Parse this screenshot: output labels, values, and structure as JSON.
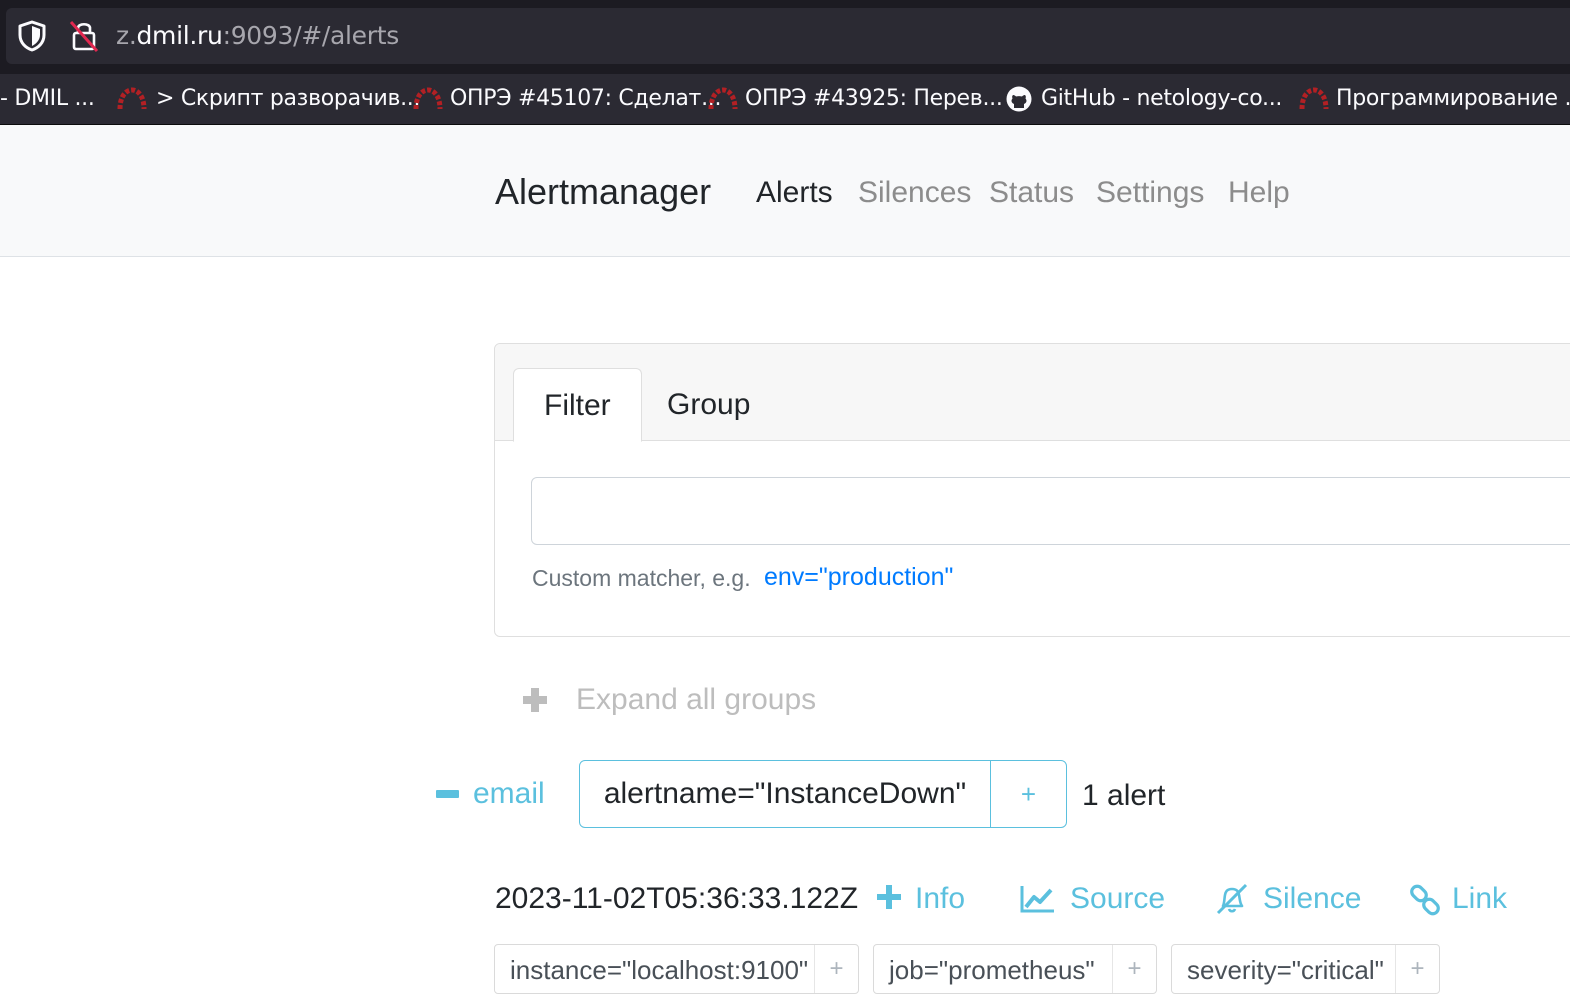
{
  "browser": {
    "url_prefix": "z.",
    "url_host": "dmil.ru",
    "url_rest": ":9093/#/alerts",
    "bookmarks": [
      {
        "label": "- DMIL ...",
        "icon": "none"
      },
      {
        "label": "> Скрипт разворачив...",
        "icon": "redmine-icon"
      },
      {
        "label": "ОПРЭ #45107: Сделат...",
        "icon": "redmine-icon"
      },
      {
        "label": "ОПРЭ #43925: Перев...",
        "icon": "redmine-icon"
      },
      {
        "label": "GitHub - netology-co...",
        "icon": "github-icon"
      },
      {
        "label": "Программирование ...",
        "icon": "redmine-icon"
      }
    ]
  },
  "navbar": {
    "brand": "Alertmanager",
    "links": [
      {
        "label": "Alerts",
        "active": true
      },
      {
        "label": "Silences",
        "active": false
      },
      {
        "label": "Status",
        "active": false
      },
      {
        "label": "Settings",
        "active": false
      },
      {
        "label": "Help",
        "active": false
      }
    ]
  },
  "filter_card": {
    "tabs": [
      {
        "label": "Filter",
        "active": true
      },
      {
        "label": "Group",
        "active": false
      }
    ],
    "input_value": "",
    "hint_text": "Custom matcher, e.g.",
    "hint_example": "env=\"production\""
  },
  "expand_all": {
    "label": "Expand all groups"
  },
  "group": {
    "receiver": "email",
    "matcher": "alertname=\"InstanceDown\"",
    "add_symbol": "+",
    "count_label": "1 alert"
  },
  "alert": {
    "timestamp": "2023-11-02T05:36:33.122Z",
    "actions": {
      "info": "Info",
      "source": "Source",
      "silence": "Silence",
      "link": "Link"
    },
    "labels": [
      {
        "text": "instance=\"localhost:9100\"",
        "add": "+"
      },
      {
        "text": "job=\"prometheus\"",
        "add": "+"
      },
      {
        "text": "severity=\"critical\"",
        "add": "+"
      }
    ]
  },
  "colors": {
    "accent_info": "#5bc0de",
    "link_blue": "#007bff",
    "navbar_bg": "#f8f9fa",
    "chrome_dark": "#1c1b22"
  }
}
